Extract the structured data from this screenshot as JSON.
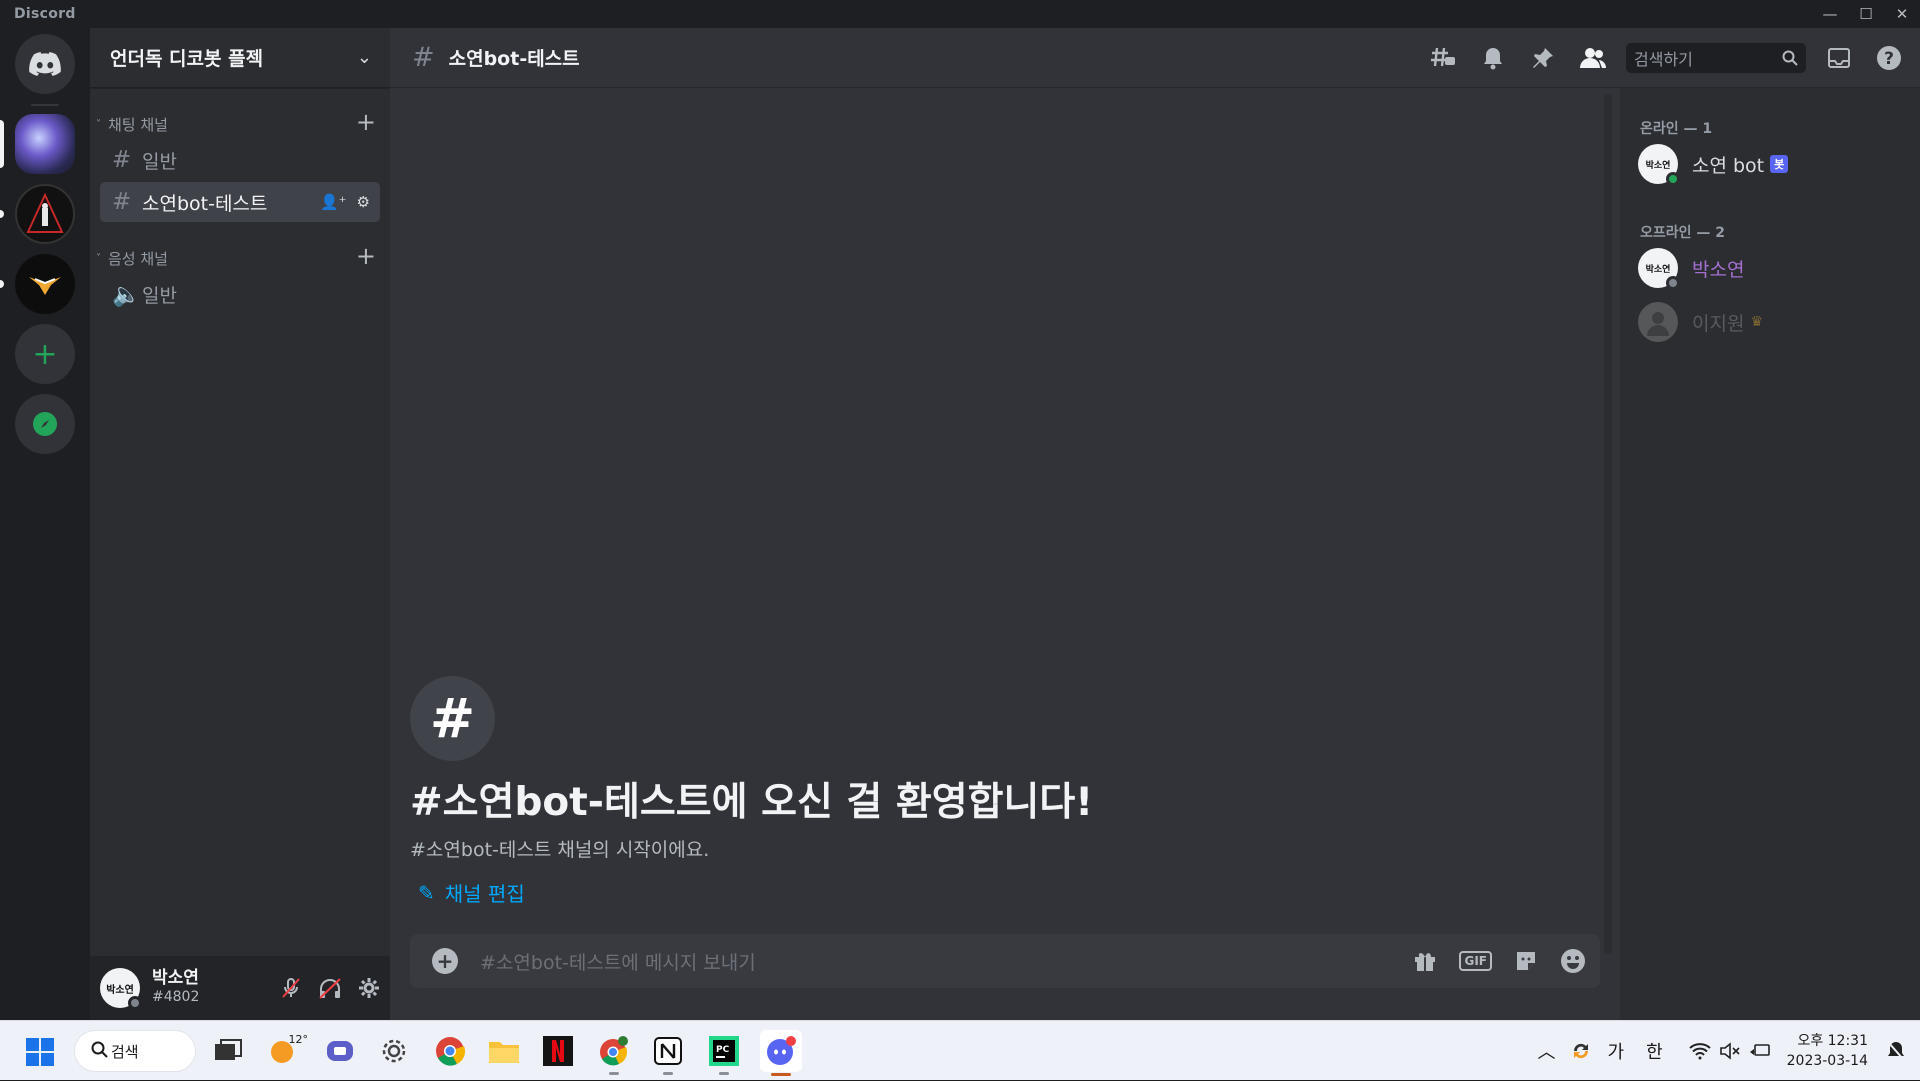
{
  "window": {
    "title": "Discord"
  },
  "guild": {
    "name": "언더독 디코봇 플젝"
  },
  "categories": [
    {
      "label": "채팅 채널"
    },
    {
      "label": "음성 채널"
    }
  ],
  "channels": {
    "text": [
      {
        "label": "일반"
      },
      {
        "label": "소연bot-테스트"
      }
    ],
    "voice": [
      {
        "label": "일반"
      }
    ]
  },
  "user": {
    "name": "박소연",
    "tag": "#4802",
    "avatar_text": "박소연"
  },
  "header": {
    "channel": "소연bot-테스트",
    "search_placeholder": "검색하기"
  },
  "welcome": {
    "title": "#소연bot-테스트에 오신 걸 환영합니다!",
    "subtitle": "#소연bot-테스트 채널의 시작이에요.",
    "edit_label": "채널 편집"
  },
  "composer": {
    "placeholder": "#소연bot-테스트에 메시지 보내기",
    "gif_label": "GIF"
  },
  "members": {
    "online_header": "온라인 — 1",
    "offline_header": "오프라인 — 2",
    "online": [
      {
        "name": "소연 bot",
        "badge": "봇",
        "color": "#dbdee1",
        "status": "#23a559"
      }
    ],
    "offline": [
      {
        "name": "박소연",
        "color": "#a56fd1",
        "status": "#80848e"
      },
      {
        "name": "이지원",
        "color": "#5c5f66",
        "status": ""
      }
    ]
  },
  "taskbar": {
    "search_label": "검색",
    "weather_temp": "12°",
    "ime_lang": "가",
    "ime_mode": "한",
    "time": "오후 12:31",
    "date": "2023-03-14"
  },
  "colors": {
    "accent": "#5865f2",
    "link": "#00a8fc",
    "online": "#23a559"
  }
}
